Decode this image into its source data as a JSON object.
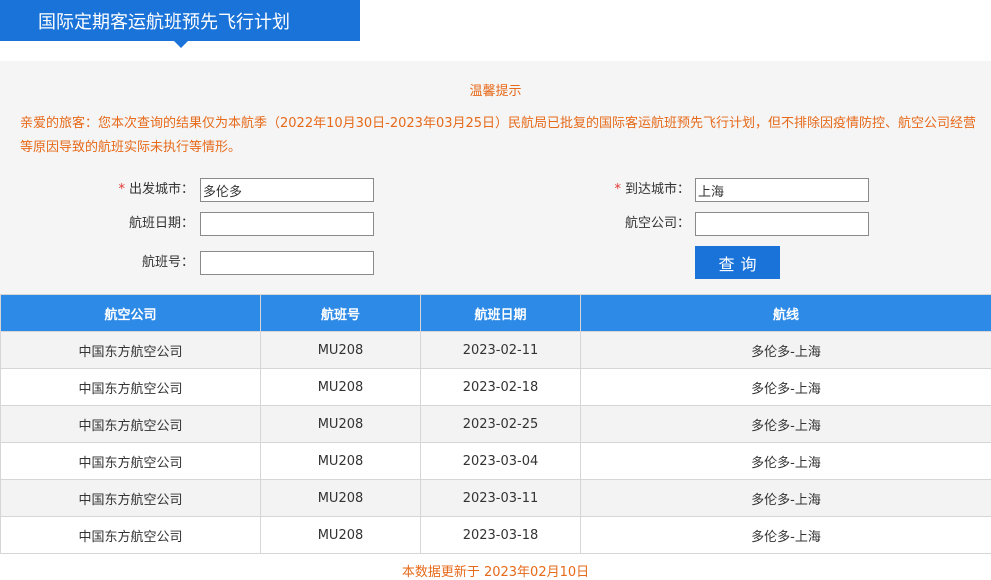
{
  "header": {
    "title": "国际定期客运航班预先飞行计划"
  },
  "notice": {
    "title": "温馨提示",
    "text": "亲爱的旅客：您本次查询的结果仅为本航季（2022年10月30日-2023年03月25日）民航局已批复的国际客运航班预先飞行计划，但不排除因疫情防控、航空公司经营等原因导致的航班实际未执行等情形。"
  },
  "form": {
    "required_mark": "*",
    "departure_label": "出发城市：",
    "departure_value": "多伦多",
    "arrival_label": "到达城市：",
    "arrival_value": "上海",
    "date_label": "航班日期：",
    "date_value": "",
    "airline_label": "航空公司：",
    "airline_value": "",
    "flight_no_label": "航班号：",
    "flight_no_value": "",
    "query_button": "查询"
  },
  "table": {
    "headers": [
      "航空公司",
      "航班号",
      "航班日期",
      "航线"
    ],
    "rows": [
      [
        "中国东方航空公司",
        "MU208",
        "2023-02-11",
        "多伦多-上海"
      ],
      [
        "中国东方航空公司",
        "MU208",
        "2023-02-18",
        "多伦多-上海"
      ],
      [
        "中国东方航空公司",
        "MU208",
        "2023-02-25",
        "多伦多-上海"
      ],
      [
        "中国东方航空公司",
        "MU208",
        "2023-03-04",
        "多伦多-上海"
      ],
      [
        "中国东方航空公司",
        "MU208",
        "2023-03-11",
        "多伦多-上海"
      ],
      [
        "中国东方航空公司",
        "MU208",
        "2023-03-18",
        "多伦多-上海"
      ]
    ]
  },
  "footer": {
    "update_note": "本数据更新于 2023年02月10日"
  },
  "colors": {
    "brand_blue": "#1a73d9",
    "header_blue": "#2d8ae6",
    "notice_orange": "#e66a1a",
    "required_red": "#e0322f"
  }
}
